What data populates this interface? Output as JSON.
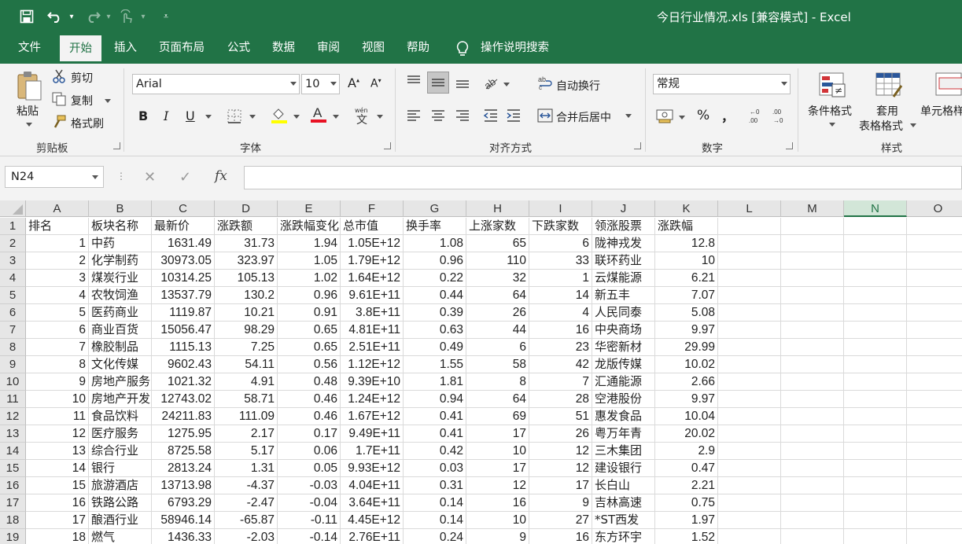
{
  "window": {
    "title": "今日行业情况.xls  [兼容模式]  -  Excel"
  },
  "tabs": [
    "文件",
    "开始",
    "插入",
    "页面布局",
    "公式",
    "数据",
    "审阅",
    "视图",
    "帮助"
  ],
  "active_tab": "开始",
  "tell_me": "操作说明搜索",
  "clipboard": {
    "paste": "粘贴",
    "cut": "剪切",
    "copy": "复制",
    "format_painter": "格式刷",
    "label": "剪贴板"
  },
  "font": {
    "name": "Arial",
    "size": "10",
    "bold": "B",
    "italic": "I",
    "underline": "U",
    "label": "字体",
    "phonetic": "wén"
  },
  "alignment": {
    "wrap_text": "自动换行",
    "merge_center": "合并后居中",
    "label": "对齐方式"
  },
  "number": {
    "format": "常规",
    "percent": "%",
    "comma": "，",
    "label": "数字"
  },
  "styles": {
    "conditional": "条件格式",
    "table1": "套用",
    "table2": "表格格式",
    "cell_styles": "单元格样式",
    "label": "样式"
  },
  "formula_bar": {
    "name_box": "N24",
    "cancel": "✕",
    "enter": "✓",
    "fx": "fx",
    "value": ""
  },
  "columns": [
    "A",
    "B",
    "C",
    "D",
    "E",
    "F",
    "G",
    "H",
    "I",
    "J",
    "K",
    "L",
    "M",
    "N",
    "O"
  ],
  "selected_column": "N",
  "headers": [
    "排名",
    "板块名称",
    "最新价",
    "涨跌额",
    "涨跌幅变化",
    "总市值",
    "换手率",
    "上涨家数",
    "下跌家数",
    "领涨股票",
    "涨跌幅"
  ],
  "rows": [
    [
      "1",
      "中药",
      "1631.49",
      "31.73",
      "1.94",
      "1.05E+12",
      "1.08",
      "65",
      "6",
      "陇神戎发",
      "12.8"
    ],
    [
      "2",
      "化学制药",
      "30973.05",
      "323.97",
      "1.05",
      "1.79E+12",
      "0.96",
      "110",
      "33",
      "联环药业",
      "10"
    ],
    [
      "3",
      "煤炭行业",
      "10314.25",
      "105.13",
      "1.02",
      "1.64E+12",
      "0.22",
      "32",
      "1",
      "云煤能源",
      "6.21"
    ],
    [
      "4",
      "农牧饲渔",
      "13537.79",
      "130.2",
      "0.96",
      "9.61E+11",
      "0.44",
      "64",
      "14",
      "新五丰",
      "7.07"
    ],
    [
      "5",
      "医药商业",
      "1119.87",
      "10.21",
      "0.91",
      "3.8E+11",
      "0.39",
      "26",
      "4",
      "人民同泰",
      "5.08"
    ],
    [
      "6",
      "商业百货",
      "15056.47",
      "98.29",
      "0.65",
      "4.81E+11",
      "0.63",
      "44",
      "16",
      "中央商场",
      "9.97"
    ],
    [
      "7",
      "橡胶制品",
      "1115.13",
      "7.25",
      "0.65",
      "2.51E+11",
      "0.49",
      "6",
      "23",
      "华密新材",
      "29.99"
    ],
    [
      "8",
      "文化传媒",
      "9602.43",
      "54.11",
      "0.56",
      "1.12E+12",
      "1.55",
      "58",
      "42",
      "龙版传媒",
      "10.02"
    ],
    [
      "9",
      "房地产服务",
      "1021.32",
      "4.91",
      "0.48",
      "9.39E+10",
      "1.81",
      "8",
      "7",
      "汇通能源",
      "2.66"
    ],
    [
      "10",
      "房地产开发",
      "12743.02",
      "58.71",
      "0.46",
      "1.24E+12",
      "0.94",
      "64",
      "28",
      "空港股份",
      "9.97"
    ],
    [
      "11",
      "食品饮料",
      "24211.83",
      "111.09",
      "0.46",
      "1.67E+12",
      "0.41",
      "69",
      "51",
      "惠发食品",
      "10.04"
    ],
    [
      "12",
      "医疗服务",
      "1275.95",
      "2.17",
      "0.17",
      "9.49E+11",
      "0.41",
      "17",
      "26",
      "粤万年青",
      "20.02"
    ],
    [
      "13",
      "综合行业",
      "8725.58",
      "5.17",
      "0.06",
      "1.7E+11",
      "0.42",
      "10",
      "12",
      "三木集团",
      "2.9"
    ],
    [
      "14",
      "银行",
      "2813.24",
      "1.31",
      "0.05",
      "9.93E+12",
      "0.03",
      "17",
      "12",
      "建设银行",
      "0.47"
    ],
    [
      "15",
      "旅游酒店",
      "13713.98",
      "-4.37",
      "-0.03",
      "4.04E+11",
      "0.31",
      "12",
      "17",
      "长白山",
      "2.21"
    ],
    [
      "16",
      "铁路公路",
      "6793.29",
      "-2.47",
      "-0.04",
      "3.64E+11",
      "0.14",
      "16",
      "9",
      "吉林高速",
      "0.75"
    ],
    [
      "17",
      "酿酒行业",
      "58946.14",
      "-65.87",
      "-0.11",
      "4.45E+12",
      "0.14",
      "10",
      "27",
      "*ST西发",
      "1.97"
    ],
    [
      "18",
      "燃气",
      "1436.33",
      "-2.03",
      "-0.14",
      "2.76E+11",
      "0.24",
      "9",
      "16",
      "东方环宇",
      "1.52"
    ]
  ],
  "colors": {
    "excel_green": "#217346",
    "ribbon_bg": "#f3f3f3"
  }
}
